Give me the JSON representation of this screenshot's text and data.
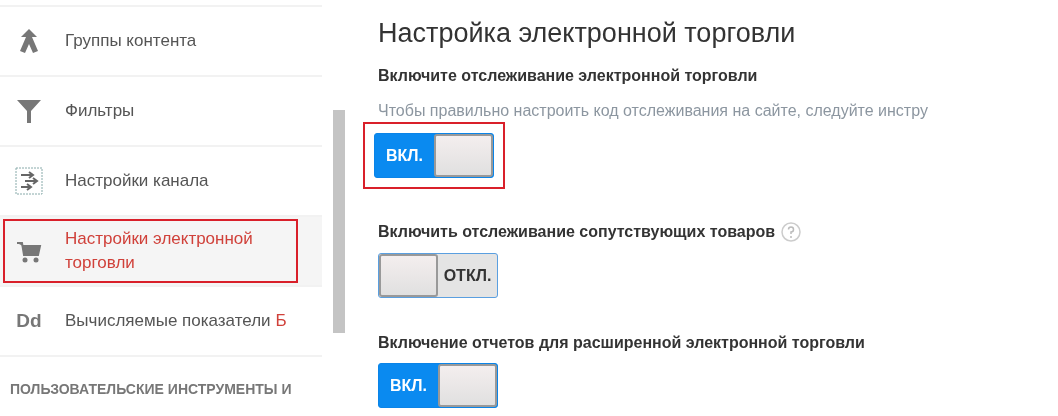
{
  "sidebar": {
    "items": [
      {
        "kind": "merge",
        "label": "Группы контента",
        "selected": false,
        "annotated": false
      },
      {
        "kind": "filter",
        "label": "Фильтры",
        "selected": false,
        "annotated": false
      },
      {
        "kind": "channel",
        "label": "Настройки канала",
        "selected": false,
        "annotated": false
      },
      {
        "kind": "cart",
        "label": "Настройки электронной торговли",
        "selected": true,
        "annotated": true
      },
      {
        "kind": "text",
        "icon_text": "Dd",
        "label": "Вычисляемые показатели",
        "badge": "Б",
        "selected": false,
        "annotated": false
      }
    ],
    "section_header": "ПОЛЬЗОВАТЕЛЬСКИЕ ИНСТРУМЕНТЫ И"
  },
  "main": {
    "title": "Настройка электронной торговли",
    "settings": [
      {
        "label": "Включите отслеживание электронной торговли",
        "description": "Чтобы правильно настроить код отслеживания на сайте, следуйте инстру",
        "help": false,
        "toggle": {
          "on": true,
          "on_text": "ВКЛ.",
          "annotated": true
        }
      },
      {
        "label": "Включить отслеживание сопутствующих товаров",
        "help": true,
        "toggle": {
          "on": false,
          "off_text": "ОТКЛ.",
          "annotated": false
        }
      },
      {
        "label": "Включение отчетов для расширенной электронной торговли",
        "help": false,
        "toggle": {
          "on": true,
          "on_text": "ВКЛ.",
          "annotated": false
        }
      }
    ]
  }
}
